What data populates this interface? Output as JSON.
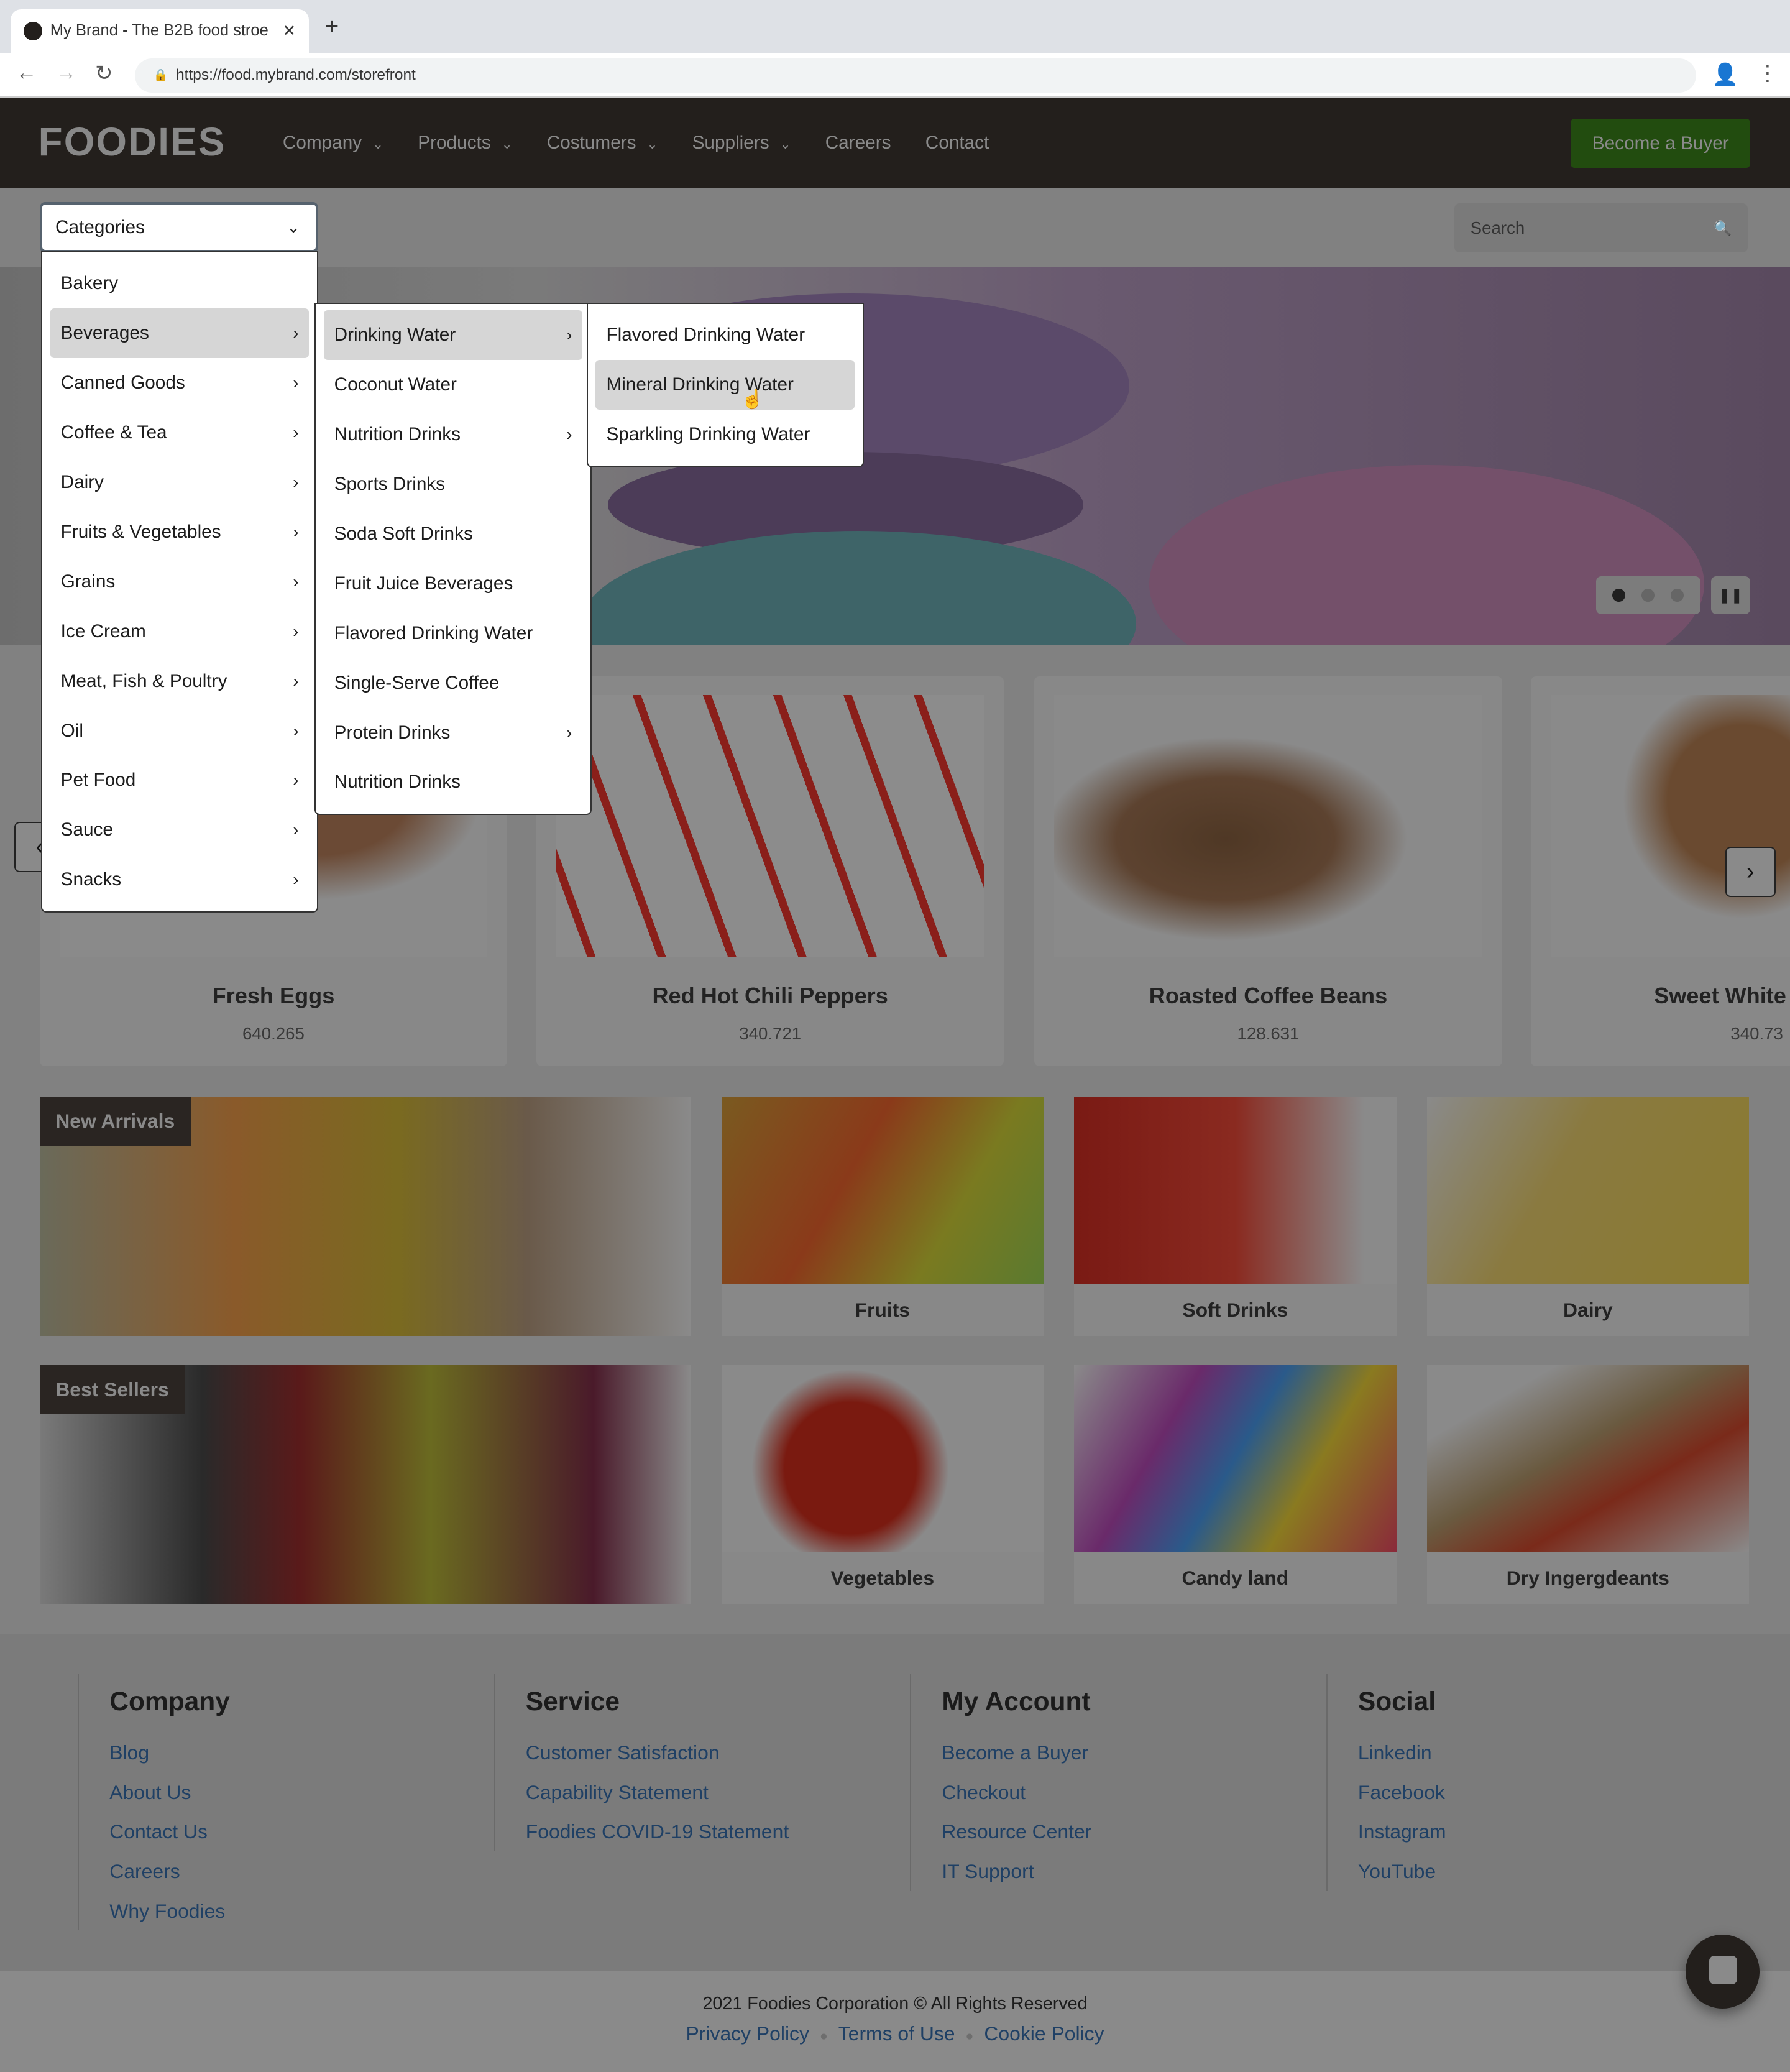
{
  "browser": {
    "tab_title": "My Brand - The B2B food stroe",
    "url": "https://food.mybrand.com/storefront"
  },
  "header": {
    "logo": "FOODIES",
    "nav": [
      {
        "label": "Company",
        "dropdown": true
      },
      {
        "label": "Products",
        "dropdown": true
      },
      {
        "label": "Costumers",
        "dropdown": true
      },
      {
        "label": "Suppliers",
        "dropdown": true
      },
      {
        "label": "Careers",
        "dropdown": false
      },
      {
        "label": "Contact",
        "dropdown": false
      }
    ],
    "cta": "Become a Buyer"
  },
  "categories": {
    "label": "Categories",
    "items": [
      "Bakery",
      "Beverages",
      "Canned Goods",
      "Coffee & Tea",
      "Dairy",
      "Fruits & Vegetables",
      "Grains",
      "Ice Cream",
      "Meat, Fish & Poultry",
      "Oil",
      "Pet Food",
      "Sauce",
      "Snacks"
    ]
  },
  "submenu": {
    "items": [
      "Drinking Water",
      "Coconut Water",
      "Nutrition Drinks",
      "Sports Drinks",
      "Soda Soft Drinks",
      "Fruit Juice Beverages",
      "Flavored Drinking Water",
      "Single-Serve Coffee",
      "Protein Drinks",
      "Nutrition Drinks"
    ]
  },
  "submenu2": {
    "items": [
      "Flavored Drinking Water",
      "Mineral Drinking Water",
      "Sparkling Drinking Water"
    ]
  },
  "search": {
    "placeholder": "Search"
  },
  "products": [
    {
      "title": "Fresh Eggs",
      "price": "640.265"
    },
    {
      "title": "Red Hot Chili Peppers",
      "price": "340.721"
    },
    {
      "title": "Roasted Coffee Beans",
      "price": "128.631"
    },
    {
      "title": "Sweet White",
      "price": "340.73"
    }
  ],
  "sections": {
    "new_arrivals": "New Arrivals",
    "best_sellers": "Best Sellers",
    "tiles": [
      "Fruits",
      "Soft Drinks",
      "Dairy",
      "Vegetables",
      "Candy land",
      "Dry Ingergdeants"
    ]
  },
  "footer": {
    "columns": [
      {
        "title": "Company",
        "links": [
          "Blog",
          "About Us",
          "Contact Us",
          "Careers",
          "Why Foodies"
        ]
      },
      {
        "title": "Service",
        "links": [
          "Customer Satisfaction",
          "Capability Statement",
          "Foodies COVID-19 Statement"
        ]
      },
      {
        "title": "My Account",
        "links": [
          "Become a Buyer",
          "Checkout",
          "Resource Center",
          "IT Support"
        ]
      },
      {
        "title": "Social",
        "links": [
          "Linkedin",
          "Facebook",
          "Instagram",
          "YouTube"
        ]
      }
    ],
    "copyright": "2021 Foodies Corporation © All Rights Reserved",
    "legal": [
      "Privacy Policy",
      "Terms of Use",
      "Cookie Policy"
    ]
  }
}
